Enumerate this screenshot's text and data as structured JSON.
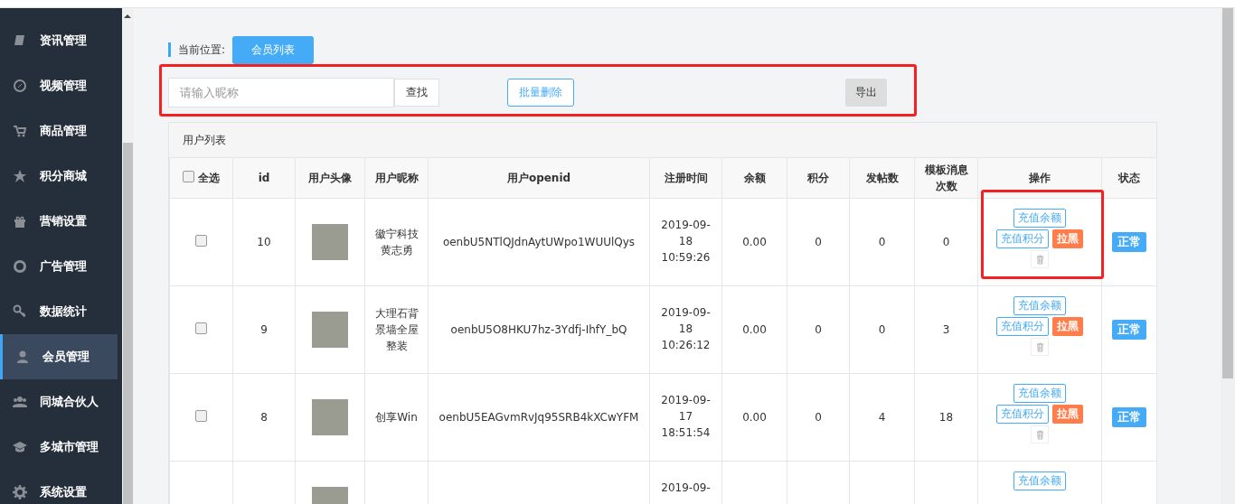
{
  "sidebar": {
    "items": [
      {
        "label": "资讯管理",
        "selected": false
      },
      {
        "label": "视频管理",
        "selected": false
      },
      {
        "label": "商品管理",
        "selected": false
      },
      {
        "label": "积分商城",
        "selected": false
      },
      {
        "label": "营销设置",
        "selected": false
      },
      {
        "label": "广告管理",
        "selected": false
      },
      {
        "label": "数据统计",
        "selected": false
      },
      {
        "label": "会员管理",
        "selected": true
      },
      {
        "label": "同城合伙人",
        "selected": false
      },
      {
        "label": "多城市管理",
        "selected": false
      },
      {
        "label": "系统设置",
        "selected": false
      }
    ]
  },
  "breadcrumb": {
    "label": "当前位置:",
    "current": "会员列表"
  },
  "toolbar": {
    "search": {
      "placeholder": "请输入昵称"
    },
    "search_button": "查找",
    "delete_button": "批量删除",
    "export_button": "导出"
  },
  "panel": {
    "title": "用户列表"
  },
  "table": {
    "select_all": {
      "label": "全选",
      "checked": false
    },
    "columns": [
      "id",
      "用户头像",
      "用户昵称",
      "用户openid",
      "注册时间",
      "余额",
      "积分",
      "发帖数",
      "模板消息次数",
      "操作",
      "状态"
    ],
    "rows": [
      {
        "checked": false,
        "id": "10",
        "nickname": "徽宁科技黄志勇",
        "openid": "oenbU5NTlQJdnAytUWpo1WUUlQys",
        "registered": "2019-09-18 10:59:26",
        "balance": "0.00",
        "points": "0",
        "posts": "0",
        "template_count": "0",
        "actions": [
          "充值余额",
          "充值积分",
          "拉黑"
        ],
        "status": "正常"
      },
      {
        "checked": false,
        "id": "9",
        "nickname": "大理石背景墙全屋整装",
        "openid": "oenbU5O8HKU7hz-3Ydfj-IhfY_bQ",
        "registered": "2019-09-18 10:26:12",
        "balance": "0.00",
        "points": "0",
        "posts": "0",
        "template_count": "3",
        "actions": [
          "充值余额",
          "充值积分",
          "拉黑"
        ],
        "status": "正常"
      },
      {
        "checked": false,
        "id": "8",
        "nickname": "创享Win",
        "openid": "oenbU5EAGvmRvJq95SRB4kXCwYFM",
        "registered": "2019-09-17 18:51:54",
        "balance": "0.00",
        "points": "0",
        "posts": "4",
        "template_count": "18",
        "actions": [
          "充值余额",
          "充值积分",
          "拉黑"
        ],
        "status": "正常"
      },
      {
        "registered": "2019-09-",
        "actions": [
          "充值余额"
        ]
      }
    ]
  }
}
